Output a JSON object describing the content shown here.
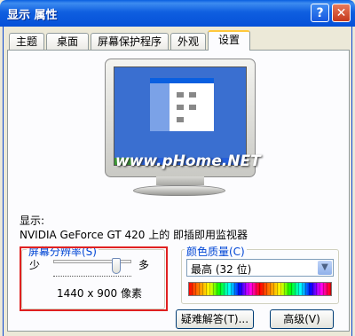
{
  "window": {
    "title": "显示 属性",
    "help_label": "?",
    "close_label": "✕"
  },
  "tabs": [
    {
      "label": "主题"
    },
    {
      "label": "桌面"
    },
    {
      "label": "屏幕保护程序"
    },
    {
      "label": "外观"
    },
    {
      "label": "设置"
    }
  ],
  "preview": {
    "watermark": "www.pHome.NET"
  },
  "display": {
    "label": "显示:",
    "device": "NVIDIA GeForce GT 420 上的 即插即用监视器"
  },
  "resolution": {
    "group_label": "屏幕分辨率(S)",
    "less_label": "少",
    "more_label": "多",
    "value_text": "1440 x 900 像素",
    "slider_level": 0.85
  },
  "color_quality": {
    "group_label": "颜色质量(C)",
    "selected": "最高 (32 位)"
  },
  "buttons": {
    "troubleshoot": "疑难解答(T)...",
    "advanced": "高级(V)"
  },
  "colors": {
    "highlight_box": "#e02020",
    "titlebar": "#0a5fe0"
  }
}
